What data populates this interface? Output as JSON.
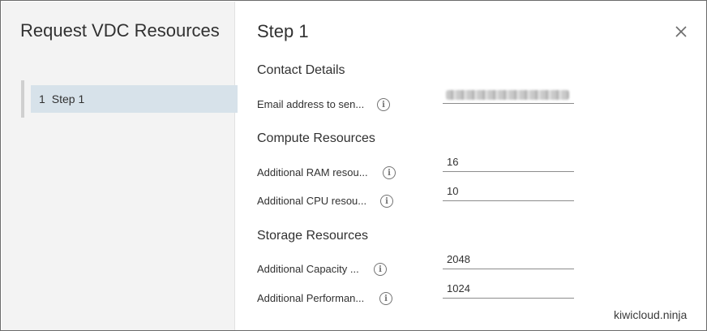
{
  "wizard": {
    "title": "Request VDC Resources"
  },
  "steps": [
    {
      "number": "1",
      "label": "Step 1"
    }
  ],
  "main": {
    "title": "Step 1",
    "sections": {
      "contact": {
        "title": "Contact Details",
        "email": {
          "label": "Email address to sen...",
          "value": ""
        }
      },
      "compute": {
        "title": "Compute Resources",
        "ram": {
          "label": "Additional RAM resou...",
          "value": "16"
        },
        "cpu": {
          "label": "Additional CPU resou...",
          "value": "10"
        }
      },
      "storage": {
        "title": "Storage Resources",
        "capacity": {
          "label": "Additional Capacity ...",
          "value": "2048"
        },
        "performance": {
          "label": "Additional Performan...",
          "value": "1024"
        }
      }
    }
  },
  "icons": {
    "info": "info-icon",
    "close": "close-icon"
  },
  "info_glyph": "i",
  "watermark": "kiwicloud.ninja",
  "colors": {
    "sidebar_bg": "#f3f3f3",
    "active_step_bg": "#d7e2ea",
    "text": "#313131"
  }
}
